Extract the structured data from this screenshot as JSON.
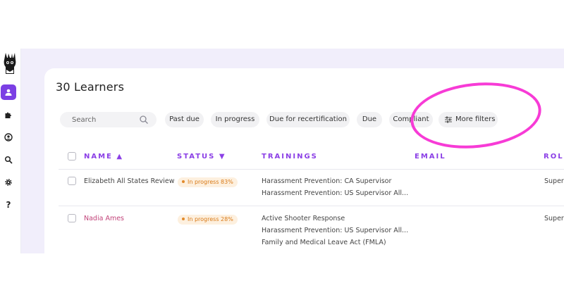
{
  "page": {
    "title": "30 Learners"
  },
  "filters": {
    "search_placeholder": "Search",
    "chips": [
      "Past due",
      "In progress",
      "Due for recertification",
      "Due",
      "Compliant"
    ],
    "more_filters": "More filters"
  },
  "table": {
    "columns": [
      "NAME ▲",
      "STATUS ▼",
      "TRAININGS",
      "EMAIL",
      "ROLE"
    ],
    "rows": [
      {
        "name": "Elizabeth All States Review",
        "status": "In progress 83%",
        "trainings": [
          "Harassment Prevention: CA Supervisor",
          "Harassment Prevention: US Supervisor All..."
        ],
        "role": "Superv"
      },
      {
        "name": "Nadia Ames",
        "status": "In progress 28%",
        "trainings": [
          "Active Shooter Response",
          "Harassment Prevention: US Supervisor All...",
          "Family and Medical Leave Act (FMLA)"
        ],
        "role": "Superv"
      }
    ]
  },
  "sidebar": {
    "icons": [
      "llama-logo",
      "user-icon",
      "puzzle-icon",
      "user-circle-icon",
      "search-icon",
      "gear-icon",
      "help-icon"
    ],
    "help_label": "?"
  },
  "colors": {
    "accent": "#7b3fe4",
    "header_text": "#8b3fe6",
    "badge_bg": "#fdf0df",
    "badge_text": "#d97a18",
    "highlight_circle": "#f73bd6",
    "link_name": "#c2447a"
  }
}
